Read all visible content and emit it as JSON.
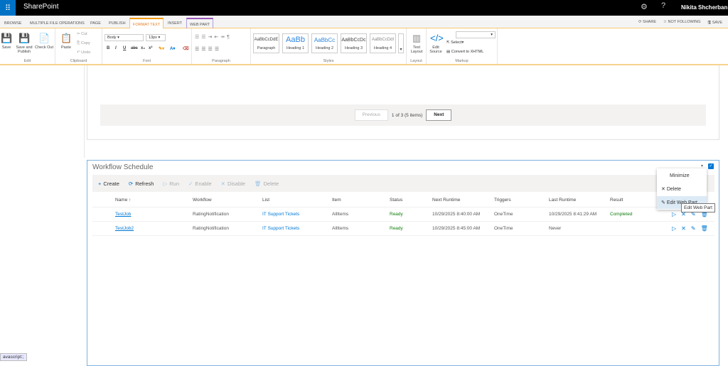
{
  "topbar": {
    "brand": "SharePoint",
    "user": "Nikita Shcherban",
    "icons": [
      "app-launcher-icon",
      "gear-icon",
      "help-icon"
    ]
  },
  "tabs": [
    "BROWSE",
    "MULTIPLE FILE OPERATIONS",
    "PAGE",
    "PUBLISH",
    "FORMAT TEXT",
    "INSERT",
    "WEB PART"
  ],
  "tab_actions": {
    "share": "SHARE",
    "follow": "NOT FOLLOWING",
    "save": "SAVE"
  },
  "ribbon": {
    "edit": {
      "label": "Edit",
      "save": "Save",
      "save_publish": "Save and Publish",
      "check_out": "Check Out"
    },
    "clipboard": {
      "label": "Clipboard",
      "paste": "Paste",
      "cut": "Cut",
      "copy": "Copy",
      "undo": "Undo"
    },
    "font": {
      "label": "Font",
      "style": "Body",
      "size": "13px"
    },
    "paragraph": {
      "label": "Paragraph"
    },
    "styles": {
      "label": "Styles",
      "items": [
        {
          "sample": "AaBbCcDdE",
          "name": "Paragraph"
        },
        {
          "sample": "AaBb",
          "name": "Heading 1"
        },
        {
          "sample": "AaBbCc",
          "name": "Heading 2"
        },
        {
          "sample": "AaBbCcDc",
          "name": "Heading 3"
        },
        {
          "sample": "AaBbCcDdI",
          "name": "Heading 4"
        }
      ]
    },
    "layout": {
      "label": "Layout",
      "text_layout": "Text Layout"
    },
    "markup": {
      "label": "Markup",
      "edit_source": "Edit Source",
      "select": "Select",
      "convert": "Convert to XHTML"
    }
  },
  "pager": {
    "previous": "Previous",
    "info": "1 of 3 (5 items)",
    "next": "Next"
  },
  "webpart": {
    "title": "Workflow Schedule",
    "toolbar": {
      "create": "Create",
      "refresh": "Refresh",
      "run": "Run",
      "enable": "Enable",
      "disable": "Disable",
      "delete": "Delete"
    },
    "columns": [
      "Name ↑",
      "Workflow",
      "List",
      "Item",
      "Status",
      "Next Runtime",
      "Triggers",
      "Last Runtime",
      "Result"
    ],
    "rows": [
      {
        "name": "TestJob",
        "workflow": "RatingNotification",
        "list": "IT Support Tickets",
        "item": "AllItems",
        "status": "Ready",
        "next": "10/29/2025 8:40:00 AM",
        "triggers": "OneTime",
        "last": "10/29/2025 8:41:29 AM",
        "result": "Completed"
      },
      {
        "name": "TestJob2",
        "workflow": "RatingNotification",
        "list": "IT Support Tickets",
        "item": "AllItems",
        "status": "Ready",
        "next": "10/29/2025 8:45:00 AM",
        "triggers": "OneTime",
        "last": "Never",
        "result": ""
      }
    ],
    "menu": {
      "minimize": "Minimize",
      "delete": "Delete",
      "edit": "Edit Web Part"
    },
    "tooltip": "Edit Web Part"
  },
  "statusbar": "avascript:;"
}
